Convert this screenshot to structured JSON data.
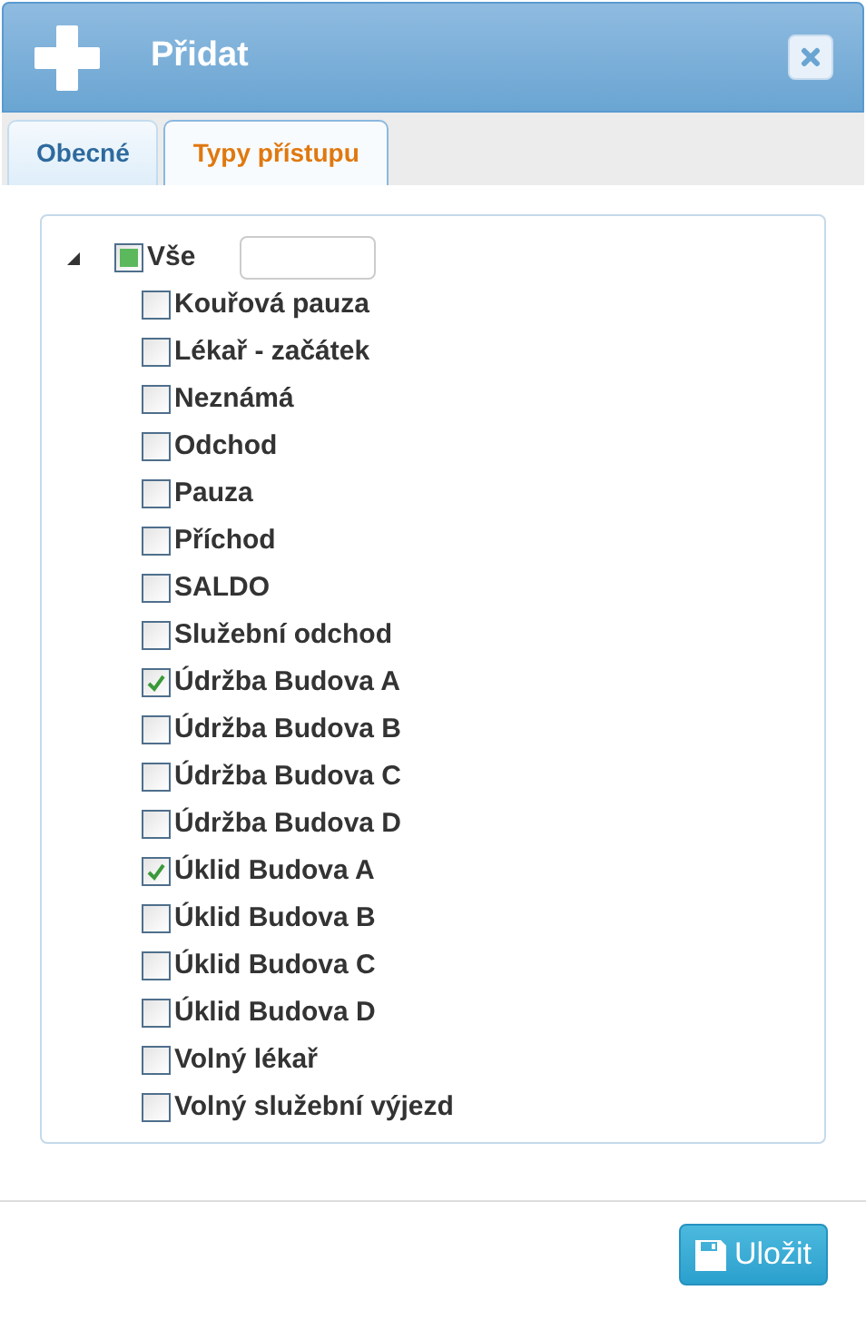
{
  "window": {
    "title": "Přidat"
  },
  "tabs": [
    {
      "label": "Obecné",
      "selected": false
    },
    {
      "label": "Typy přístupu",
      "selected": true
    }
  ],
  "tree": {
    "label": "Vše",
    "expanded": true,
    "checked": false,
    "partial": true,
    "children": [
      {
        "label": "Kouřová pauza",
        "checked": false
      },
      {
        "label": "Lékař - začátek",
        "checked": false
      },
      {
        "label": "Neznámá",
        "checked": false
      },
      {
        "label": "Odchod",
        "checked": false
      },
      {
        "label": "Pauza",
        "checked": false
      },
      {
        "label": "Příchod",
        "checked": false
      },
      {
        "label": "SALDO",
        "checked": false
      },
      {
        "label": "Služební odchod",
        "checked": false
      },
      {
        "label": "Údržba Budova A",
        "checked": true
      },
      {
        "label": "Údržba Budova B",
        "checked": false
      },
      {
        "label": "Údržba Budova C",
        "checked": false
      },
      {
        "label": "Údržba Budova D",
        "checked": false
      },
      {
        "label": "Úklid Budova A",
        "checked": true
      },
      {
        "label": "Úklid Budova B",
        "checked": false
      },
      {
        "label": "Úklid Budova C",
        "checked": false
      },
      {
        "label": "Úklid Budova D",
        "checked": false
      },
      {
        "label": "Volný lékař",
        "checked": false
      },
      {
        "label": "Volný služební výjezd",
        "checked": false
      }
    ]
  },
  "buttons": [
    {
      "label": "Uložit"
    }
  ]
}
